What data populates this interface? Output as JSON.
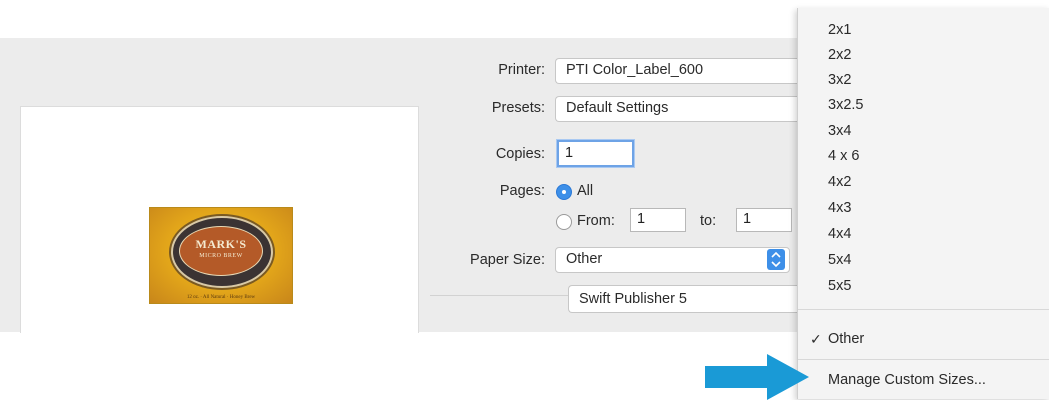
{
  "print_dialog": {
    "printer": {
      "label": "Printer:",
      "value": "PTI Color_Label_600"
    },
    "presets": {
      "label": "Presets:",
      "value": "Default Settings"
    },
    "copies": {
      "label": "Copies:",
      "value": "1"
    },
    "pages": {
      "label": "Pages:",
      "all_label": "All",
      "from_label": "From:",
      "from_value": "1",
      "to_label": "to:",
      "to_value": "1",
      "selected": "All"
    },
    "paper_size": {
      "label": "Paper Size:",
      "value": "Other"
    },
    "app_popup": {
      "value": "Swift Publisher 5"
    }
  },
  "preview": {
    "label_title": "MARK'S",
    "label_subtitle": "MICRO BREW",
    "label_footer": "12 oz. · All Natural · Honey Brew"
  },
  "paper_size_menu": {
    "items": [
      "2x1",
      "2x2",
      "3x2",
      "3x2.5",
      "3x4",
      "4 x 6",
      "4x2",
      "4x3",
      "4x4",
      "5x4",
      "5x5"
    ],
    "checked_item": "Other",
    "check_mark": "✓",
    "manage_label": "Manage Custom Sizes..."
  },
  "colors": {
    "accent": "#3d8fe8",
    "arrow": "#1a9ad6",
    "dialog_background": "#ececec"
  },
  "icons": {
    "stepper": "up-down-stepper-icon",
    "arrow": "right-arrow-icon",
    "check": "checkmark-icon"
  }
}
